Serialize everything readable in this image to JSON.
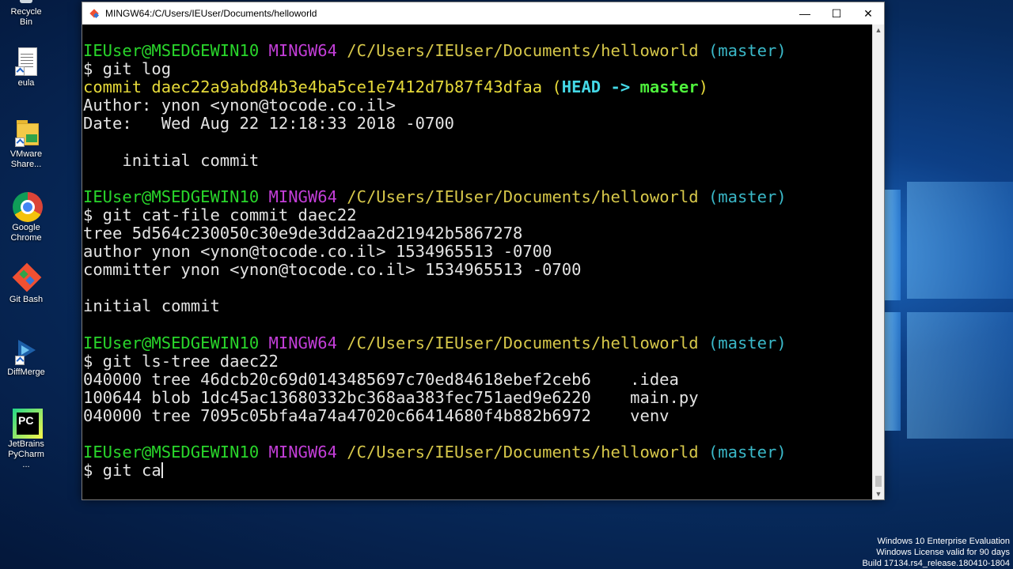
{
  "desktop": {
    "icons": [
      {
        "label": "Recycle Bin",
        "icon": "recycle-bin-icon"
      },
      {
        "label": "eula",
        "icon": "text-document-icon"
      },
      {
        "label": "VMware Share...",
        "icon": "folder-icon"
      },
      {
        "label": "Google Chrome",
        "icon": "chrome-icon"
      },
      {
        "label": "Git Bash",
        "icon": "git-bash-icon"
      },
      {
        "label": "DiffMerge",
        "icon": "diffmerge-icon"
      },
      {
        "label": "JetBrains PyCharm ...",
        "icon": "pycharm-icon"
      }
    ],
    "watermark": {
      "line1": "Windows 10 Enterprise Evaluation",
      "line2": "Windows License valid for 90 days",
      "line3": "Build 17134.rs4_release.180410-1804"
    }
  },
  "window": {
    "title": "MINGW64:/C/Users/IEUser/Documents/helloworld",
    "controls": {
      "minimize": "—",
      "maximize": "☐",
      "close": "✕"
    }
  },
  "terminal": {
    "prompt": {
      "user_host": "IEUser@MSEDGEWIN10",
      "shell": "MINGW64",
      "path": "/C/Users/IEUser/Documents/helloworld",
      "branch": "(master)"
    },
    "cmd1": "$ git log",
    "commit_prefix": "commit daec22a9abd84b3e4ba5ce1e7412d7b87f43dfaa ",
    "head_open": "(",
    "head_label": "HEAD -> ",
    "head_branch": "master",
    "head_close": ")",
    "author": "Author: ynon <ynon@tocode.co.il>",
    "date": "Date:   Wed Aug 22 12:18:33 2018 -0700",
    "msg1": "    initial commit",
    "cmd2": "$ git cat-file commit daec22",
    "tree": "tree 5d564c230050c30e9de3dd2aa2d21942b5867278",
    "author_raw": "author ynon <ynon@tocode.co.il> 1534965513 -0700",
    "committer_raw": "committer ynon <ynon@tocode.co.il> 1534965513 -0700",
    "msg2": "initial commit",
    "cmd3": "$ git ls-tree daec22",
    "ls1": "040000 tree 46dcb20c69d0143485697c70ed84618ebef2ceb6    .idea",
    "ls2": "100644 blob 1dc45ac13680332bc368aa383fec751aed9e6220    main.py",
    "ls3": "040000 tree 7095c05bfa4a74a47020c66414680f4b882b6972    venv",
    "cmd4": "$ git ca"
  }
}
